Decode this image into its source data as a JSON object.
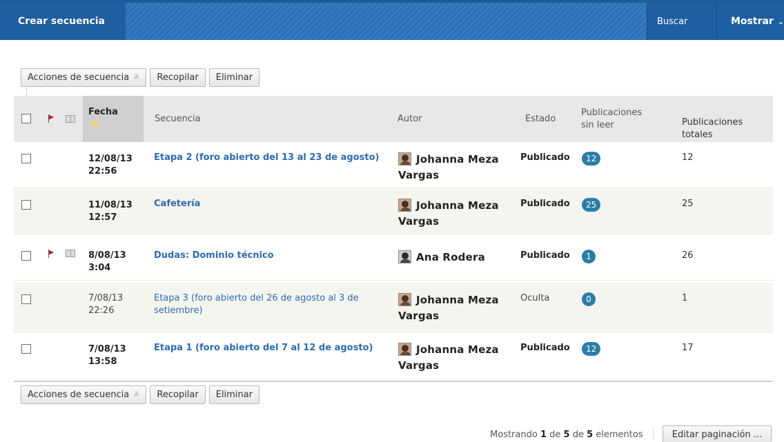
{
  "topbar": {
    "create_label": "Crear secuencia",
    "search_label": "Buscar",
    "show_label": "Mostrar",
    "show_chevron": "⌄"
  },
  "actions": {
    "sequence_actions": "Acciones de secuencia",
    "dropdown_glyph": "≚",
    "collect": "Recopilar",
    "delete": "Eliminar"
  },
  "table": {
    "headers": {
      "date": "Fecha",
      "sequence": "Secuencia",
      "author": "Autor",
      "state": "Estado",
      "unread_line1": "Publicaciones",
      "unread_line2": "sin leer",
      "total_line1": "Publicaciones",
      "total_line2": "totales"
    },
    "rows": [
      {
        "date": "12/08/13",
        "time": "22:56",
        "title": "Etapa 2 (foro abierto del 13 al 23 de agosto)",
        "author_line1": "Johanna Meza",
        "author_line2": "Vargas",
        "state": "Publicado",
        "unread": "12",
        "total": "12",
        "flagged": false,
        "bold": true
      },
      {
        "date": "11/08/13",
        "time": "12:57",
        "title": "Cafetería",
        "author_line1": "Johanna Meza",
        "author_line2": "Vargas",
        "state": "Publicado",
        "unread": "25",
        "total": "25",
        "flagged": false,
        "bold": true
      },
      {
        "date": "8/08/13",
        "time": "3:04",
        "title": "Dudas: Dominio técnico",
        "author_line1": "Ana Rodera",
        "author_line2": "",
        "state": "Publicado",
        "unread": "1",
        "total": "26",
        "flagged": true,
        "bold": true
      },
      {
        "date": "7/08/13",
        "time": "22:26",
        "title_line1": "Etapa 3 (foro abierto del 26 de agosto al 3 de",
        "title_line2": "setiembre)",
        "author_line1": "Johanna Meza",
        "author_line2": "Vargas",
        "state": "Oculta",
        "unread": "0",
        "total": "1",
        "flagged": false,
        "bold": false
      },
      {
        "date": "7/08/13",
        "time": "13:58",
        "title": "Etapa 1 (foro abierto del 7 al 12 de agosto)",
        "author_line1": "Johanna Meza",
        "author_line2": "Vargas",
        "state": "Publicado",
        "unread": "12",
        "total": "17",
        "flagged": false,
        "bold": true
      }
    ]
  },
  "footer": {
    "showing_prefix": "Mostrando",
    "from": "1",
    "of1": "de",
    "to": "5",
    "of2": "de",
    "count": "5",
    "suffix": "elementos",
    "edit_pagination": "Editar paginación ..."
  },
  "colors": {
    "topbar": "#2a72b8",
    "link": "#2c6ab0",
    "badge": "#2a7ea6",
    "flag": "#b52525"
  }
}
